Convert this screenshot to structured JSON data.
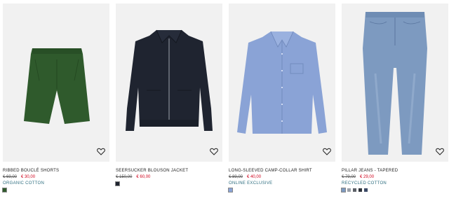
{
  "products": [
    {
      "name": "RIBBED BOUCLÉ SHORTS",
      "old_price": "€ 69,00",
      "new_price": "€ 30,00",
      "tag": "ORGANIC COTTON",
      "swatches": [
        "#2f5a2c"
      ],
      "image_icon": "shorts-image",
      "wishlist_icon": "heart-outline-icon"
    },
    {
      "name": "SEERSUCKER BLOUSON JACKET",
      "old_price": "€ 150,00",
      "new_price": "€ 60,00",
      "tag": "",
      "swatches": [
        "#1f2430"
      ],
      "image_icon": "jacket-image",
      "wishlist_icon": "heart-outline-icon"
    },
    {
      "name": "LONG-SLEEVED CAMP-COLLAR SHIRT",
      "old_price": "€ 89,00",
      "new_price": "€ 40,00",
      "tag": "ONLINE EXCLUSIVE",
      "swatches": [
        "#8aa3d6"
      ],
      "image_icon": "shirt-image",
      "wishlist_icon": "heart-outline-icon"
    },
    {
      "name": "PILLAR JEANS - TAPERED",
      "old_price": "€ 79,00",
      "new_price": "€ 29,00",
      "tag": "RECYCLED COTTON",
      "swatches": [
        "#7d9ac0",
        "#9aa0a8",
        "#5d6168",
        "#30343b",
        "#3b4a66"
      ],
      "image_icon": "jeans-image",
      "wishlist_icon": "heart-outline-icon"
    }
  ],
  "colors": {
    "sale_price": "#d0021b",
    "tag": "#2f6f80",
    "image_bg": "#f1f1f1"
  }
}
